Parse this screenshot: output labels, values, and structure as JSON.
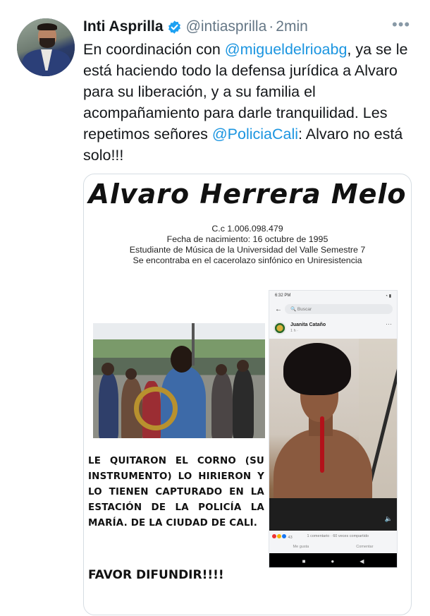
{
  "tweet": {
    "author": {
      "display_name": "Inti Asprilla",
      "handle": "@intiasprilla",
      "time": "2min",
      "verified_icon": "verified-badge-icon"
    },
    "more_label": "•••",
    "text": {
      "part1": "En coordinación con ",
      "mention1": "@migueldelrioabg",
      "part2": ",  ya se le está haciendo todo la defensa jurídica a Alvaro para su liberación, y a su familia el acompañamiento para darle tranquilidad. Les repetimos señores ",
      "mention2": "@PoliciaCali",
      "part3": ": Alvaro no está solo!!!"
    },
    "colors": {
      "link": "#1b95e0",
      "verified": "#1da1f2",
      "muted": "#657786"
    }
  },
  "poster": {
    "title": "Alvaro Herrera Melo",
    "info": [
      "C.c 1.006.098.479",
      "Fecha de nacimiento: 16 octubre de 1995",
      "Estudiante de Música de la Universidad del Valle Semestre 7",
      "Se encontraba en el cacerolazo sinfónico en Uniresistencia"
    ],
    "caption": "LE QUITARON EL CORNO (SU INSTRUMENTO) LO HIRIERON Y LO TIENEN CAPTURADO EN LA ESTACIÓN DE LA POLICÍA LA MARÍA. DE LA CIUDAD DE CALI.",
    "cta": "FAVOR DIFUNDIR!!!!"
  },
  "phone_screenshot": {
    "status_time": "6:32 PM",
    "search_placeholder": "Buscar",
    "post_author": "Juanita Cataño",
    "post_meta": "1 h ·",
    "reaction_count": "43",
    "stats": "1 comentario · 60 veces compartido",
    "action_like": "Me gusta",
    "action_comment": "Comentar"
  }
}
